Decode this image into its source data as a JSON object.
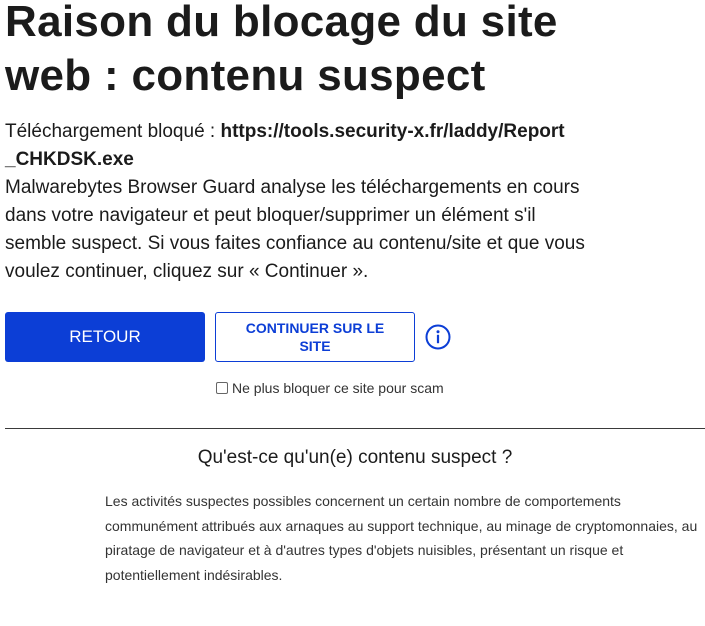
{
  "title": "Raison du blocage du site web : contenu suspect",
  "download": {
    "label": "Téléchargement bloqué : ",
    "url": "https://tools.security-x.fr/laddy/Report_CHKDSK.exe"
  },
  "description": "Malwarebytes Browser Guard analyse les téléchargements en cours dans votre navigateur et peut bloquer/supprimer un élément s'il semble suspect. Si vous faites confiance au contenu/site et que vous voulez continuer, cliquez sur « Continuer ».",
  "actions": {
    "back_label": "RETOUR",
    "continue_label": "CONTINUER SUR LE SITE",
    "info_icon": "info-circle-icon"
  },
  "checkbox": {
    "label": "Ne plus bloquer ce site pour scam",
    "checked": false
  },
  "faq": {
    "heading": "Qu'est-ce qu'un(e) contenu suspect ?",
    "text": "Les activités suspectes possibles concernent un certain nombre de comportements communément attribués aux arnaques au support technique, au minage de cryptomonnaies, au piratage de navigateur et à d'autres types d'objets nuisibles, présentant un risque et potentiellement indésirables."
  },
  "colors": {
    "accent": "#0c3ed6",
    "text": "#1b1b1b"
  }
}
